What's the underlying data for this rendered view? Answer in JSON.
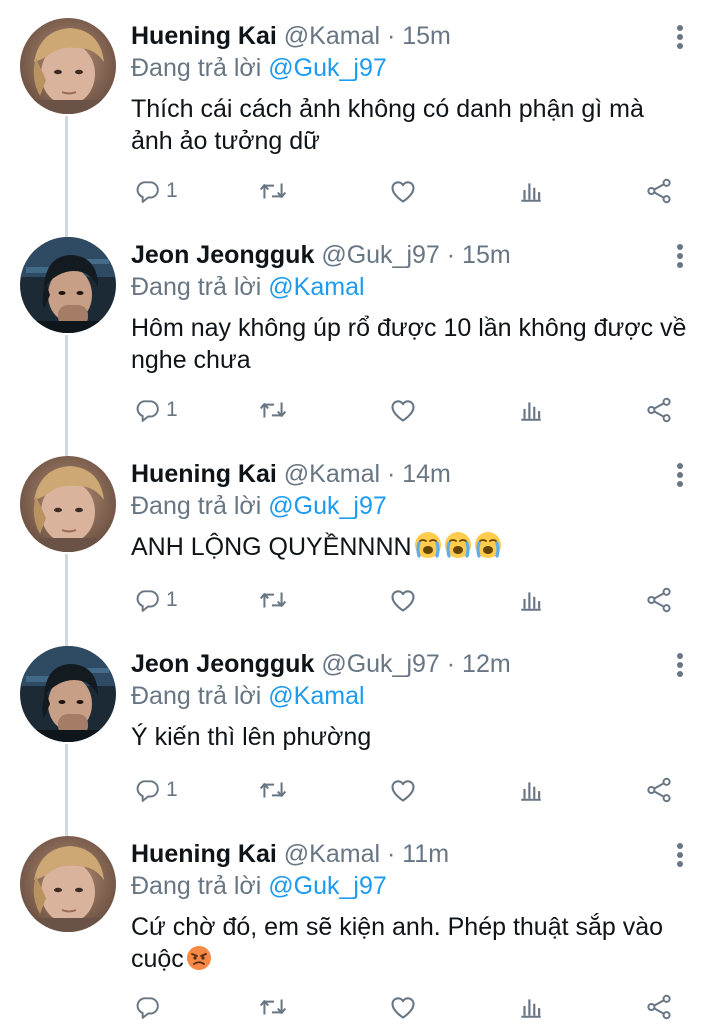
{
  "colors": {
    "name": "#0f1419",
    "secondary": "#687684",
    "mention": "#1d9bf0",
    "thread_line": "#cfd9de"
  },
  "tweets": [
    {
      "display_name": "Huening Kai",
      "meta": "@Kamal · 15m",
      "reply_prefix": "Đang trả lời",
      "reply_mention": "@Guk_j97",
      "text": "Thích cái cách ảnh không có danh phận gì mà ảnh ảo tưởng dữ",
      "reply_count": "1",
      "avatar": "blond-avatar",
      "emoji": []
    },
    {
      "display_name": "Jeon Jeongguk",
      "meta": "@Guk_j97 · 15m",
      "reply_prefix": "Đang trả lời",
      "reply_mention": "@Kamal",
      "text": "Hôm nay không úp rổ được 10 lần không được về nghe chưa",
      "reply_count": "1",
      "avatar": "dark-hair-avatar",
      "emoji": []
    },
    {
      "display_name": "Huening Kai",
      "meta": "@Kamal · 14m",
      "reply_prefix": "Đang trả lời",
      "reply_mention": "@Guk_j97",
      "text": "ANH LỘNG QUYỀNNNN",
      "reply_count": "1",
      "avatar": "blond-avatar",
      "emoji": [
        "loudly-crying-face",
        "loudly-crying-face",
        "loudly-crying-face"
      ]
    },
    {
      "display_name": "Jeon Jeongguk",
      "meta": "@Guk_j97 · 12m",
      "reply_prefix": "Đang trả lời",
      "reply_mention": "@Kamal",
      "text": "Ý kiến thì lên phường",
      "reply_count": "1",
      "avatar": "dark-hair-avatar",
      "emoji": []
    },
    {
      "display_name": "Huening Kai",
      "meta": "@Kamal · 11m",
      "reply_prefix": "Đang trả lời",
      "reply_mention": "@Guk_j97",
      "text": "Cứ chờ đó, em sẽ kiện anh. Phép thuật sắp vào cuộc",
      "reply_count": "",
      "avatar": "blond-avatar",
      "emoji": [
        "angry-face"
      ]
    }
  ],
  "icons": {
    "reply": "reply-icon",
    "retweet": "retweet-icon",
    "like": "heart-icon",
    "views": "analytics-icon",
    "share": "share-icon",
    "more": "more-vertical-icon"
  }
}
